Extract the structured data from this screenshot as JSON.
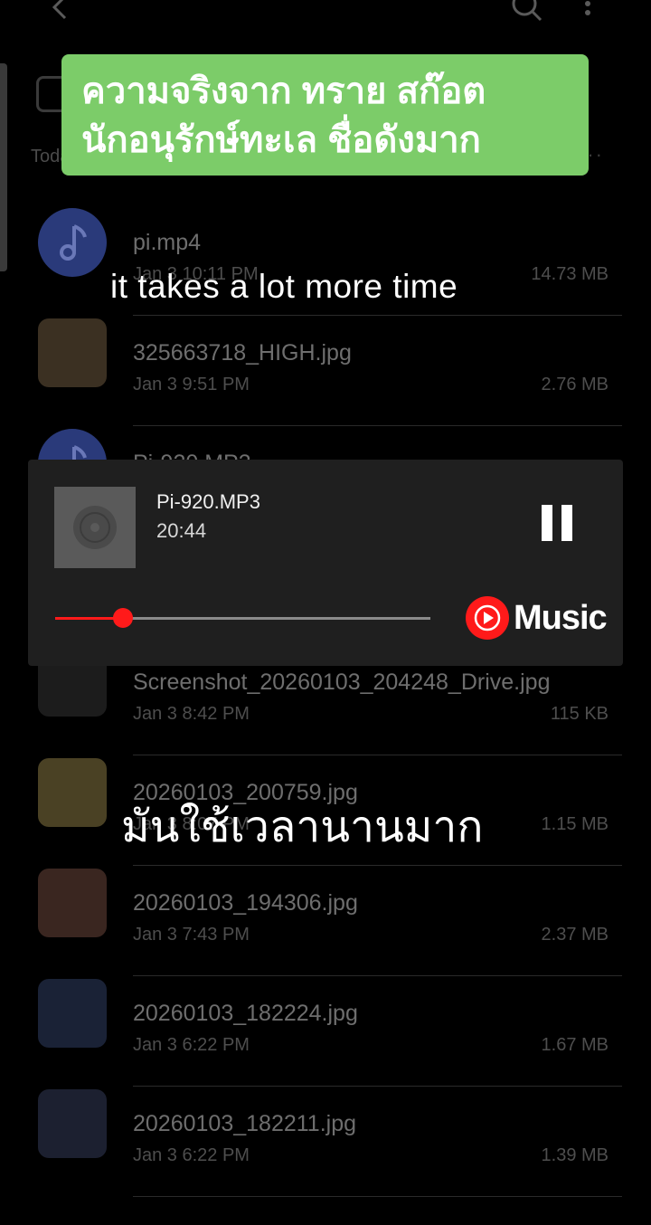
{
  "banner": {
    "line1": "ความจริงจาก ทราย สก๊อต",
    "line2": "นักอนุรักษ์ทะเล ชื่อดังมาก"
  },
  "section": {
    "label": "Toda"
  },
  "subtitles": {
    "english": "it takes a lot more time",
    "thai": "มันใช้เวลานานมาก"
  },
  "files": [
    {
      "name": "pi.mp4",
      "date": "Jan 3 10:11 PM",
      "size": "14.73 MB",
      "icon": "music-note-icon"
    },
    {
      "name": "325663718_HIGH.jpg",
      "date": "Jan 3 9:51 PM",
      "size": "2.76 MB",
      "icon": "image-thumbnail"
    },
    {
      "name": "Pi-920.MP3",
      "date": "",
      "size": "",
      "icon": "music-note-icon"
    },
    {
      "name": "Screenshot_20260103_204248_Drive.jpg",
      "date": "Jan 3 8:42 PM",
      "size": "115 KB",
      "icon": "image-thumbnail"
    },
    {
      "name": "20260103_200759.jpg",
      "date": "Jan 3 8:07 PM",
      "size": "1.15 MB",
      "icon": "image-thumbnail"
    },
    {
      "name": "20260103_194306.jpg",
      "date": "Jan 3 7:43 PM",
      "size": "2.37 MB",
      "icon": "image-thumbnail"
    },
    {
      "name": "20260103_182224.jpg",
      "date": "Jan 3 6:22 PM",
      "size": "1.67 MB",
      "icon": "image-thumbnail"
    },
    {
      "name": "20260103_182211.jpg",
      "date": "Jan 3 6:22 PM",
      "size": "1.39 MB",
      "icon": "image-thumbnail"
    }
  ],
  "player": {
    "title": "Pi-920.MP3",
    "time": "20:44",
    "progress": 0.18,
    "brand": "Music",
    "accent": "#ff1a1a"
  },
  "colors": {
    "banner_bg": "#7ccc69"
  }
}
